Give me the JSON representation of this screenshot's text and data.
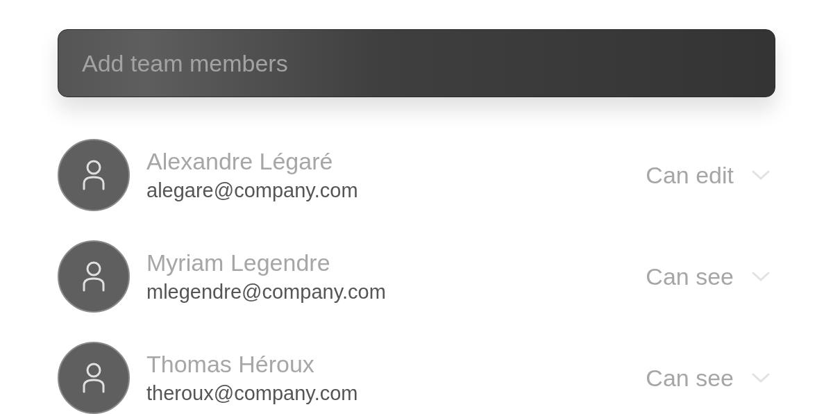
{
  "search": {
    "placeholder": "Add team members"
  },
  "members": [
    {
      "name": "Alexandre Légaré",
      "email": "alegare@company.com",
      "permission": "Can edit"
    },
    {
      "name": "Myriam Legendre",
      "email": "mlegendre@company.com",
      "permission": "Can see"
    },
    {
      "name": "Thomas Héroux",
      "email": "theroux@company.com",
      "permission": "Can see"
    }
  ]
}
